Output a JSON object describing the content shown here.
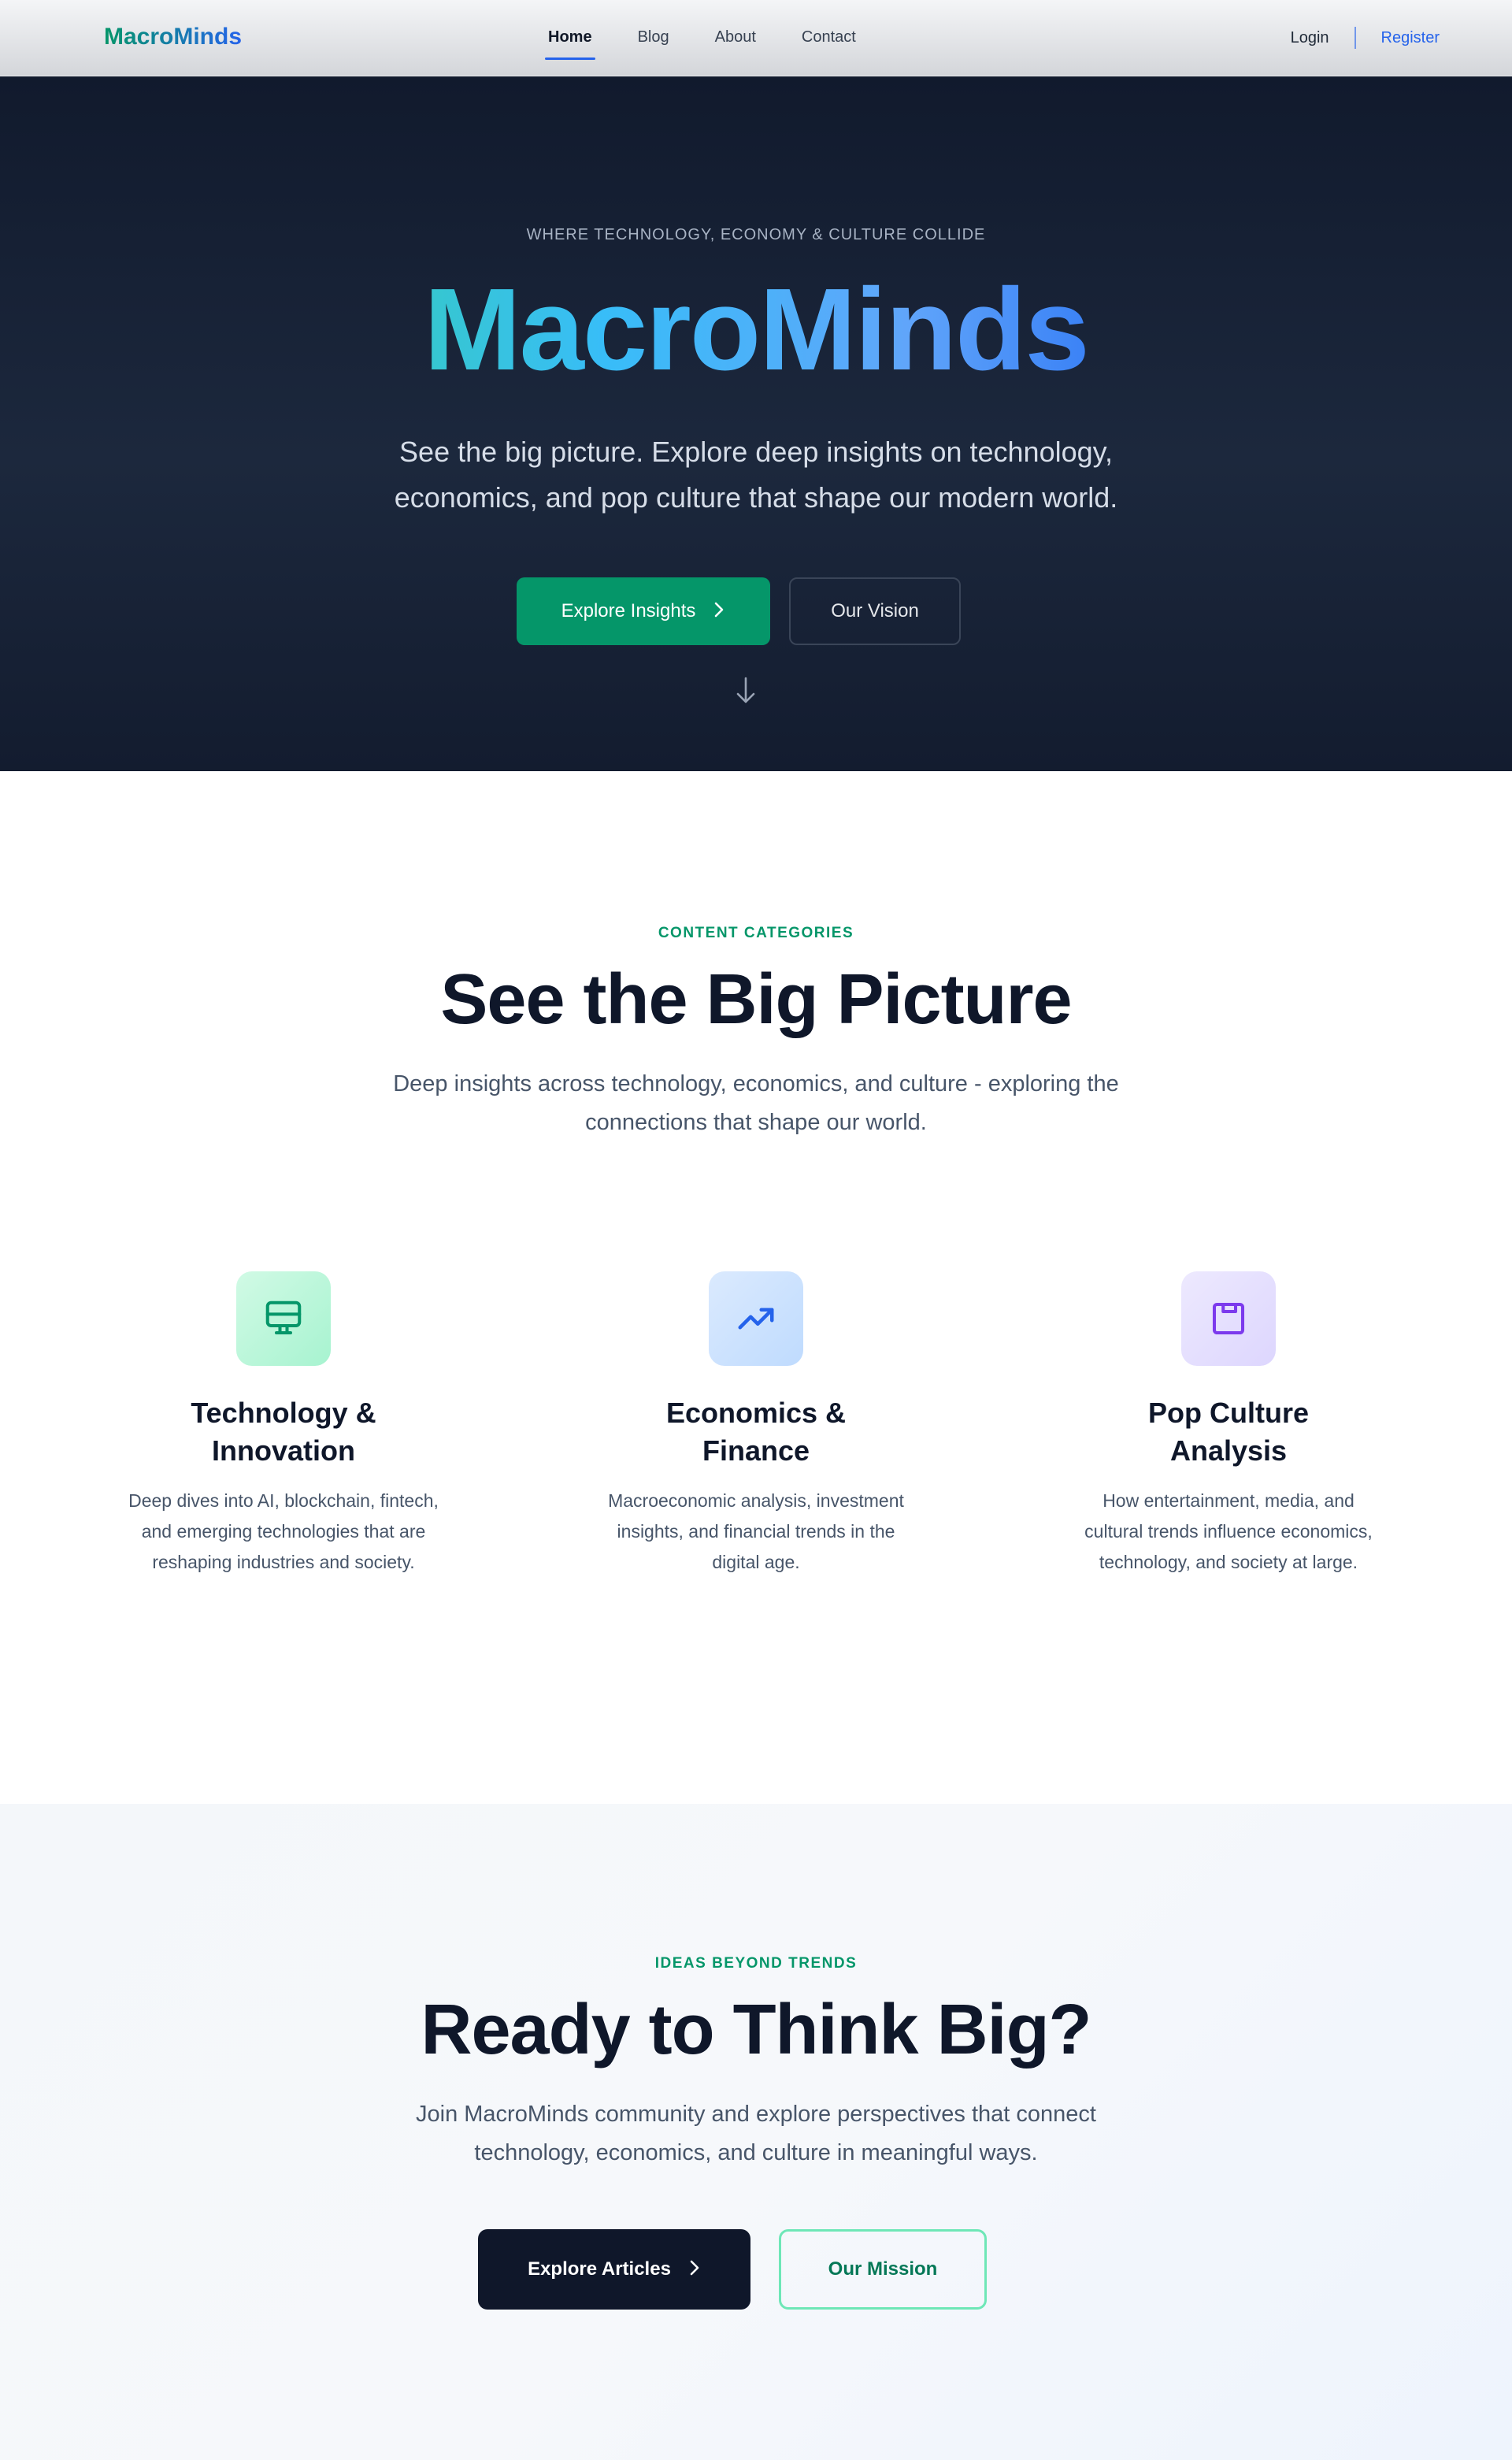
{
  "nav": {
    "brand": "MacroMinds",
    "links": [
      "Home",
      "Blog",
      "About",
      "Contact"
    ],
    "active": "Home",
    "login": "Login",
    "register": "Register"
  },
  "hero": {
    "eyebrow": "WHERE TECHNOLOGY, ECONOMY & CULTURE COLLIDE",
    "title": "MacroMinds",
    "subtitle": "See the big picture. Explore deep insights on technology, economics, and pop culture that shape our modern world.",
    "primary_button": "Explore Insights",
    "secondary_button": "Our Vision"
  },
  "categories": {
    "eyebrow": "CONTENT CATEGORIES",
    "title": "See the Big Picture",
    "subtitle": "Deep insights across technology, economics, and culture - exploring the connections that shape our world.",
    "items": [
      {
        "icon": "monitor-icon",
        "title": "Technology & Innovation",
        "description": "Deep dives into AI, blockchain, fintech, and emerging technologies that are reshaping industries and society.",
        "icon_color": "#059669"
      },
      {
        "icon": "trending-up-icon",
        "title": "Economics & Finance",
        "description": "Macroeconomic analysis, investment insights, and financial trends in the digital age.",
        "icon_color": "#2563eb"
      },
      {
        "icon": "frame-icon",
        "title": "Pop Culture Analysis",
        "description": "How entertainment, media, and cultural trends influence economics, technology, and society at large.",
        "icon_color": "#7c3aed"
      }
    ]
  },
  "cta": {
    "eyebrow": "IDEAS BEYOND TRENDS",
    "title": "Ready to Think Big?",
    "subtitle": "Join MacroMinds community and explore perspectives that connect technology, economics, and culture in meaningful ways.",
    "primary_button": "Explore Articles",
    "secondary_button": "Our Mission"
  }
}
